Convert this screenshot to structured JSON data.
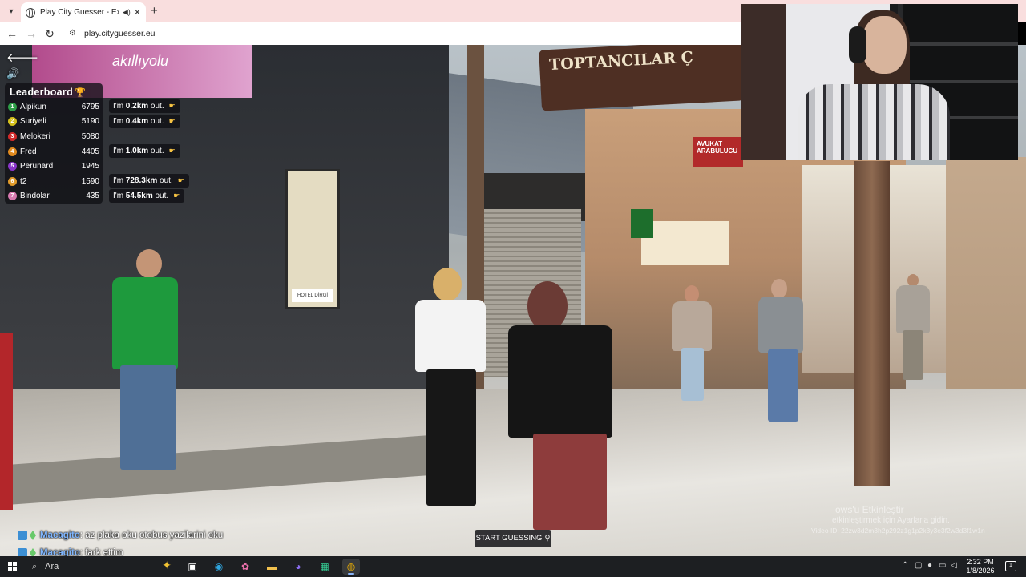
{
  "browser": {
    "tab_title": "Play City Guesser - Explore",
    "tab_audio_icon": "speaker-icon",
    "tab_close": "✕",
    "new_tab": "+",
    "url": "play.cityguesser.eu"
  },
  "scene": {
    "pink_sign_text": "akıllıyolu",
    "brown_sign_text": "TOPTANCILAR Ç",
    "window_tag_text": "HOTEL DİRGİ",
    "red_sign_text": "AVUKAT ARABULUCU"
  },
  "leaderboard": {
    "title": "Leaderboard",
    "trophy_icon": "trophy-icon",
    "rows": [
      {
        "rank": "1",
        "name": "Alpikun",
        "score": "6795",
        "color": "#2e9e47"
      },
      {
        "rank": "2",
        "name": "Suriyeli",
        "score": "5190",
        "color": "#d4c01c"
      },
      {
        "rank": "3",
        "name": "Melokeri",
        "score": "5080",
        "color": "#d12a2a"
      },
      {
        "rank": "4",
        "name": "Fred",
        "score": "4405",
        "color": "#e08a1e"
      },
      {
        "rank": "5",
        "name": "Perunard",
        "score": "1945",
        "color": "#8a35c9"
      },
      {
        "rank": "6",
        "name": "t2",
        "score": "1590",
        "color": "#e09a2a"
      },
      {
        "rank": "7",
        "name": "Bindolar",
        "score": "435",
        "color": "#d87ab0"
      }
    ]
  },
  "distances": [
    {
      "prefix": "I'm ",
      "value": "0.2km",
      "suffix": " out."
    },
    {
      "prefix": "I'm ",
      "value": "0.4km",
      "suffix": " out."
    },
    {
      "prefix": "I'm ",
      "value": "1.0km",
      "suffix": " out."
    },
    {
      "prefix": "I'm ",
      "value": "728.3km",
      "suffix": " out."
    },
    {
      "prefix": "I'm ",
      "value": "54.5km",
      "suffix": " out."
    }
  ],
  "start_guessing": "START GUESSING",
  "chat": [
    {
      "user": "Macagito",
      "message": ": az plaka oku otobus yazilarini oku"
    },
    {
      "user": "Macagito",
      "message": ": fark ettim"
    }
  ],
  "watermark": {
    "line1": "ows'u Etkinleştir",
    "line2": "etkinleştirmek için Ayarlar'a gidin.",
    "line3": "Video ID: 22zw3d2m3h2p292z1g1p2k3y3e3f2w3d3f1w1n"
  },
  "taskbar": {
    "search_placeholder": "Ara",
    "time": "2:32 PM",
    "date": "1/8/2026",
    "notification_count": "1"
  }
}
